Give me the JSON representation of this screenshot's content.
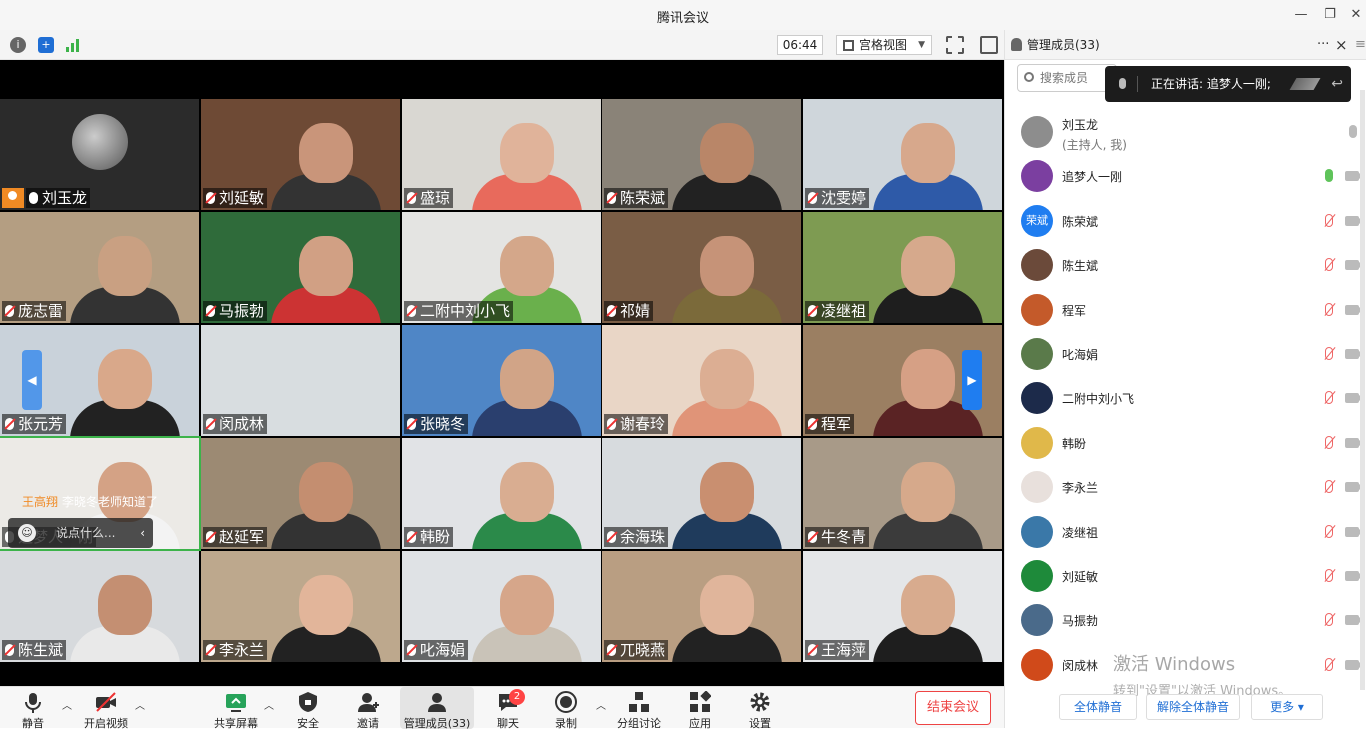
{
  "window": {
    "title": "腾讯会议"
  },
  "topbar": {
    "timer": "06:44",
    "view_mode": "宫格视图"
  },
  "tiles": [
    {
      "name": "刘玉龙",
      "mic": "active",
      "host": true,
      "bg": "#2b2b2b",
      "skin": "#9a9a9a",
      "shirt": "#2b2b2b"
    },
    {
      "name": "刘延敏",
      "mic": "muted",
      "bg": "#6e4a35",
      "skin": "#c9957a",
      "shirt": "#333"
    },
    {
      "name": "盛琼",
      "mic": "muted",
      "bg": "#d9d7d2",
      "skin": "#e0b39a",
      "shirt": "#e86a5c"
    },
    {
      "name": "陈荣斌",
      "mic": "muted",
      "bg": "#8a8378",
      "skin": "#b98668",
      "shirt": "#222"
    },
    {
      "name": "沈雯婷",
      "mic": "muted",
      "bg": "#cfd6db",
      "skin": "#d7a88c",
      "shirt": "#2e5aa8"
    },
    {
      "name": "庞志雷",
      "mic": "muted",
      "bg": "#b49e82",
      "skin": "#c9a082",
      "shirt": "#333"
    },
    {
      "name": "马振勃",
      "mic": "muted",
      "bg": "#2f6b3a",
      "skin": "#d1a084",
      "shirt": "#c33"
    },
    {
      "name": "二附中刘小飞",
      "mic": "muted",
      "bg": "#e4e4e2",
      "skin": "#d4a78a",
      "shirt": "#6ab04c"
    },
    {
      "name": "祁婧",
      "mic": "muted",
      "bg": "#7a5d45",
      "skin": "#c69378",
      "shirt": "#7b6a3a"
    },
    {
      "name": "凌继祖",
      "mic": "muted",
      "bg": "#7e9b52",
      "skin": "#d6a98c",
      "shirt": "#1e1e1e"
    },
    {
      "name": "张元芳",
      "mic": "muted",
      "bg": "#c9d2da",
      "skin": "#d9a88a",
      "shirt": "#222"
    },
    {
      "name": "闵成林",
      "mic": "muted",
      "bg": "#d8dde0",
      "skin": "#d8dde0",
      "shirt": "#d8dde0"
    },
    {
      "name": "张晓冬",
      "mic": "muted",
      "bg": "#4f86c6",
      "skin": "#d1a487",
      "shirt": "#2a3f6e"
    },
    {
      "name": "谢春玲",
      "mic": "muted",
      "bg": "#e9d6c6",
      "skin": "#dcae93",
      "shirt": "#e09478"
    },
    {
      "name": "程军",
      "mic": "muted",
      "bg": "#9b7f62",
      "skin": "#d6a085",
      "shirt": "#5a2324"
    },
    {
      "name": "追梦人一刚",
      "mic": "active",
      "bg": "#eceae6",
      "skin": "#d4a285",
      "shirt": "#f3f3f3",
      "highlight": true
    },
    {
      "name": "赵延军",
      "mic": "muted",
      "bg": "#9c8a73",
      "skin": "#c48e70",
      "shirt": "#333"
    },
    {
      "name": "韩盼",
      "mic": "muted",
      "bg": "#e1e3e6",
      "skin": "#d9ad91",
      "shirt": "#2b8a4a"
    },
    {
      "name": "余海珠",
      "mic": "muted",
      "bg": "#d7dbde",
      "skin": "#c98f70",
      "shirt": "#1f3b5c"
    },
    {
      "name": "牛冬青",
      "mic": "muted",
      "bg": "#a89a88",
      "skin": "#d6a98b",
      "shirt": "#3b3b3b"
    },
    {
      "name": "陈生斌",
      "mic": "muted",
      "bg": "#d7dadd",
      "skin": "#c48f72",
      "shirt": "#e9e9e9"
    },
    {
      "name": "李永兰",
      "mic": "muted",
      "bg": "#bda88d",
      "skin": "#e2b59a",
      "shirt": "#222"
    },
    {
      "name": "叱海娟",
      "mic": "muted",
      "bg": "#dfe2e5",
      "skin": "#d6a68a",
      "shirt": "#c9c3b8"
    },
    {
      "name": "兀晓燕",
      "mic": "muted",
      "bg": "#b99e82",
      "skin": "#e0b59b",
      "shirt": "#222"
    },
    {
      "name": "王海萍",
      "mic": "muted",
      "bg": "#e4e6e8",
      "skin": "#d8ab8e",
      "shirt": "#1e1e1e"
    }
  ],
  "chat": {
    "sender": "王高翔",
    "message": "李晓冬老师知道了",
    "placeholder": "说点什么..."
  },
  "bottombar": {
    "mute": "静音",
    "video": "开启视频",
    "share": "共享屏幕",
    "security": "安全",
    "invite": "邀请",
    "manage": "管理成员(33)",
    "chat": "聊天",
    "chat_badge": "2",
    "record": "录制",
    "breakout": "分组讨论",
    "apps": "应用",
    "settings": "设置",
    "end": "结束会议"
  },
  "panel": {
    "title": "管理成员(33)",
    "more": "···",
    "close": "×",
    "search_placeholder": "搜索成员",
    "speaking": "正在讲话: 追梦人一刚;",
    "members": [
      {
        "name": "刘玉龙",
        "sub": "(主持人, 我)",
        "mic": "idle",
        "avatar_color": "#8d8d8d"
      },
      {
        "name": "追梦人一刚",
        "mic": "on",
        "avatar_color": "#7b3fa0"
      },
      {
        "name": "陈荣斌",
        "mic": "off",
        "avatar_color": "#1f7df0",
        "avatar_text": "荣斌"
      },
      {
        "name": "陈生斌",
        "mic": "off",
        "avatar_color": "#6b4a3a"
      },
      {
        "name": "程军",
        "mic": "off",
        "avatar_color": "#c45a2a"
      },
      {
        "name": "叱海娟",
        "mic": "off",
        "avatar_color": "#5a7a4a"
      },
      {
        "name": "二附中刘小飞",
        "mic": "off",
        "avatar_color": "#1c2a4a"
      },
      {
        "name": "韩盼",
        "mic": "off",
        "avatar_color": "#e0b84a"
      },
      {
        "name": "李永兰",
        "mic": "off",
        "avatar_color": "#e8e0dc"
      },
      {
        "name": "凌继祖",
        "mic": "off",
        "avatar_color": "#3a78a8"
      },
      {
        "name": "刘延敏",
        "mic": "off",
        "avatar_color": "#1e8a3a"
      },
      {
        "name": "马振勃",
        "mic": "off",
        "avatar_color": "#4a6a8a"
      },
      {
        "name": "闵成林",
        "mic": "off",
        "avatar_color": "#d04a1a"
      }
    ],
    "mute_all": "全体静音",
    "unmute_all": "解除全体静音",
    "more_btn": "更多 ▾"
  },
  "watermark": {
    "line1": "激活 Windows",
    "line2": "转到\"设置\"以激活 Windows。"
  }
}
